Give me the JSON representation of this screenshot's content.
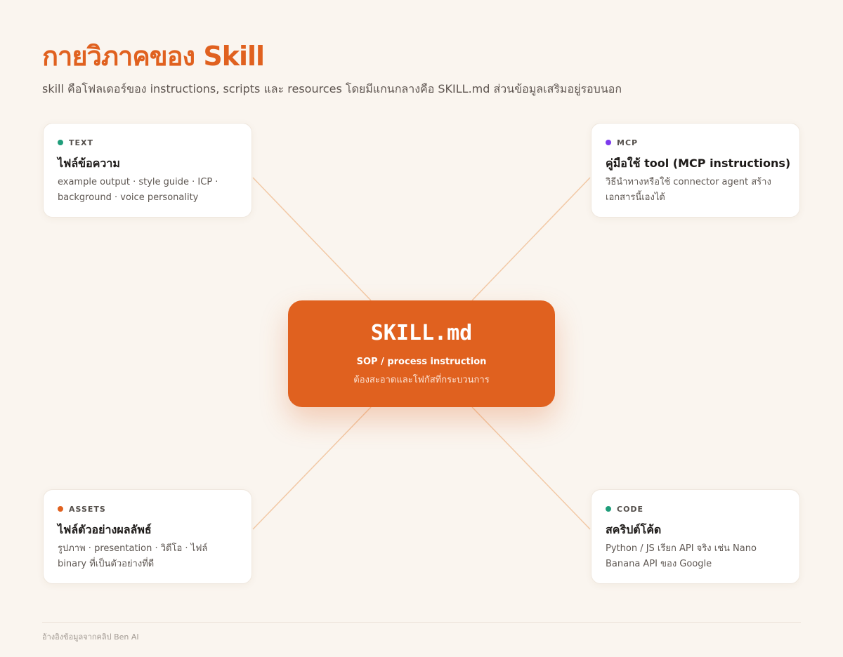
{
  "header": {
    "title": "กายวิภาคของ Skill",
    "subtitle": "skill คือโฟลเดอร์ของ instructions, scripts และ resources โดยมีแกนกลางคือ SKILL.md ส่วนข้อมูลเสริมอยู่รอบนอก"
  },
  "center": {
    "title": "SKILL.md",
    "subtitle": "SOP / process instruction",
    "note": "ต้องสะอาดและโฟกัสที่กระบวนการ"
  },
  "cards": [
    {
      "tag": "TEXT",
      "color": "#1f9d7a",
      "title": "ไฟล์ข้อความ",
      "description": "example output · style guide · ICP · background · voice personality"
    },
    {
      "tag": "MCP",
      "color": "#7c3aed",
      "title": "คู่มือใช้ tool (MCP instructions)",
      "description": "วิธีนำทางหรือใช้ connector agent สร้างเอกสารนี้เองได้"
    },
    {
      "tag": "ASSETS",
      "color": "#e0611f",
      "title": "ไฟล์ตัวอย่างผลลัพธ์",
      "description": "รูปภาพ · presentation · วิดีโอ · ไฟล์ binary ที่เป็นตัวอย่างที่ดี"
    },
    {
      "tag": "CODE",
      "color": "#1f9d7a",
      "title": "สคริปต์โค้ด",
      "description": "Python / JS เรียก API จริง เช่น Nano Banana API ของ Google"
    }
  ],
  "colors": {
    "accent": "#e0611f",
    "background": "#faf5ef",
    "connector": "#f2c9a6"
  },
  "footer": {
    "text": "อ้างอิงข้อมูลจากคลิป Ben AI"
  }
}
